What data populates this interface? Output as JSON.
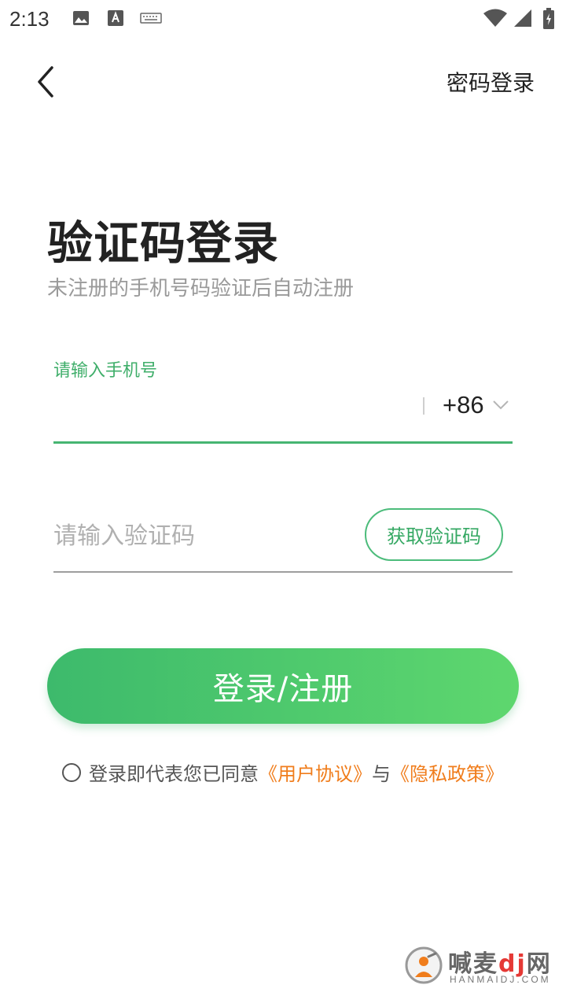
{
  "status_bar": {
    "time": "2:13",
    "icons": [
      "image-icon",
      "font-icon",
      "keyboard-icon",
      "wifi-icon",
      "signal-icon",
      "battery-charging-icon"
    ]
  },
  "header": {
    "password_login": "密码登录"
  },
  "main": {
    "title": "验证码登录",
    "subtitle": "未注册的手机号码验证后自动注册",
    "phone": {
      "label": "请输入手机号",
      "value": "",
      "country_code": "+86"
    },
    "code": {
      "placeholder": "请输入验证码",
      "value": "",
      "get_code_label": "获取验证码"
    },
    "login_button": "登录/注册",
    "agreement": {
      "prefix": "登录即代表您已同意",
      "user_agreement": "《用户协议》",
      "conjunction": "与",
      "privacy_policy": "《隐私政策》",
      "checked": false
    }
  },
  "watermark": {
    "name_part1": "喊麦",
    "name_highlight": "dj",
    "name_part2": "网",
    "domain": "HANMAIDJ.COM"
  },
  "colors": {
    "accent": "#46b572",
    "link": "#f07d1c"
  }
}
